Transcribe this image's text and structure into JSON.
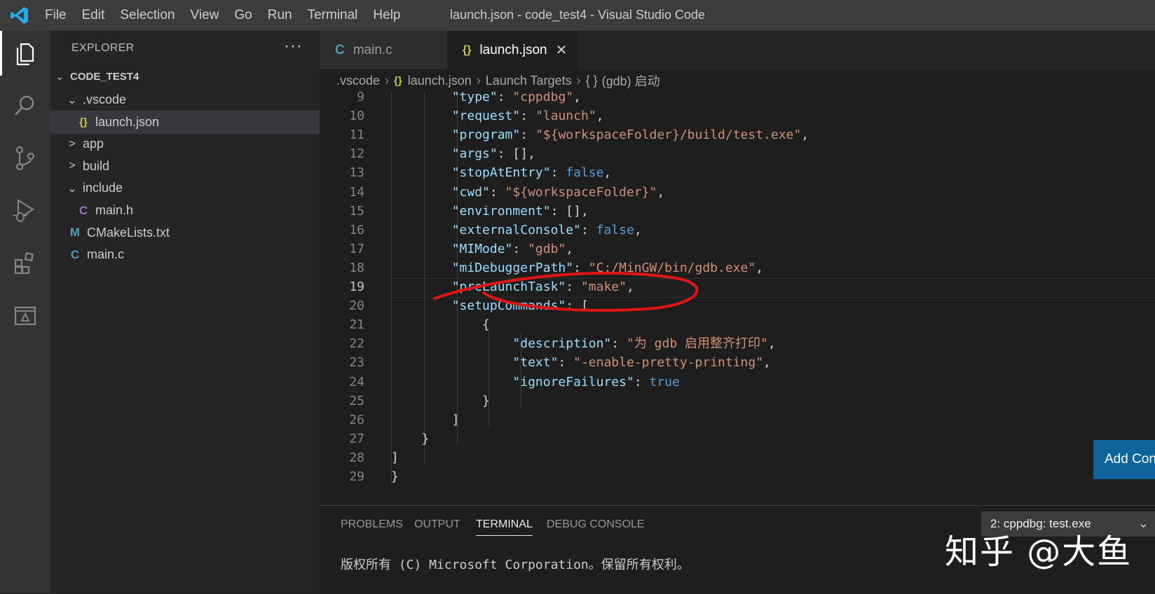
{
  "window": {
    "menu": [
      "File",
      "Edit",
      "Selection",
      "View",
      "Go",
      "Run",
      "Terminal",
      "Help"
    ],
    "title": "launch.json - code_test4 - Visual Studio Code"
  },
  "activity_bar": {
    "items": [
      "explorer-icon",
      "search-icon",
      "source-control-icon",
      "run-debug-icon",
      "extensions-icon",
      "remote-explorer-icon"
    ],
    "active": "explorer-icon"
  },
  "sidebar": {
    "title": "EXPLORER",
    "more": "···",
    "root": "CODE_TEST4",
    "tree": [
      {
        "label": ".vscode",
        "chevron": "⌄",
        "icon": ""
      },
      {
        "label": "launch.json",
        "chevron": "",
        "icon": "{}"
      },
      {
        "label": "app",
        "chevron": ">",
        "icon": ""
      },
      {
        "label": "build",
        "chevron": ">",
        "icon": ""
      },
      {
        "label": "include",
        "chevron": "⌄",
        "icon": ""
      },
      {
        "label": "main.h",
        "chevron": "",
        "icon": "C"
      },
      {
        "label": "CMakeLists.txt",
        "chevron": "",
        "icon": "M"
      },
      {
        "label": "main.c",
        "chevron": "",
        "icon": "C"
      }
    ],
    "selected": "launch.json"
  },
  "tabs": [
    {
      "label": "main.c",
      "icon": "C"
    },
    {
      "label": "launch.json",
      "icon": "{}",
      "close": "✕"
    }
  ],
  "breadcrumb": {
    "folder": ".vscode",
    "file_icon": "{}",
    "file": "launch.json",
    "section": "Launch Targets",
    "item_icon": "{ }",
    "item": "(gdb) 启动"
  },
  "code_lines": [
    {
      "n": "9",
      "code": "            \"type\": \"cppdbg\","
    },
    {
      "n": "10",
      "code": "            \"request\": \"launch\","
    },
    {
      "n": "11",
      "code": "            \"program\": \"${workspaceFolder}/build/test.exe\","
    },
    {
      "n": "12",
      "code": "            \"args\": [],"
    },
    {
      "n": "13",
      "code": "            \"stopAtEntry\": false,"
    },
    {
      "n": "14",
      "code": "            \"cwd\": \"${workspaceFolder}\","
    },
    {
      "n": "15",
      "code": "            \"environment\": [],"
    },
    {
      "n": "16",
      "code": "            \"externalConsole\": false,"
    },
    {
      "n": "17",
      "code": "            \"MIMode\": \"gdb\","
    },
    {
      "n": "18",
      "code": "            \"miDebuggerPath\": \"C:/MinGW/bin/gdb.exe\","
    },
    {
      "n": "19",
      "code": "            \"preLaunchTask\": \"make\","
    },
    {
      "n": "20",
      "code": "            \"setupCommands\": ["
    },
    {
      "n": "21",
      "code": "                {"
    },
    {
      "n": "22",
      "code": "                    \"description\": \"为 gdb 启用整齐打印\","
    },
    {
      "n": "23",
      "code": "                    \"text\": \"-enable-pretty-printing\","
    },
    {
      "n": "24",
      "code": "                    \"ignoreFailures\": true"
    },
    {
      "n": "25",
      "code": "                }"
    },
    {
      "n": "26",
      "code": "            ]"
    },
    {
      "n": "27",
      "code": "        }"
    },
    {
      "n": "28",
      "code": "    ]"
    },
    {
      "n": "29",
      "code": "}"
    }
  ],
  "current_line": "19",
  "add_config_button": "Add Con",
  "panel": {
    "tabs": [
      "PROBLEMS",
      "OUTPUT",
      "TERMINAL",
      "DEBUG CONSOLE"
    ],
    "active_tab": "TERMINAL",
    "terminal_select": "2: cppdbg: test.exe",
    "terminal_text": "版权所有 (C) Microsoft Corporation。保留所有权利。"
  },
  "watermark": "知乎 @大鱼",
  "colors": {
    "key": "#9cdcfe",
    "string": "#ce9178",
    "boolean": "#569cd6",
    "annotation_circle": "#e01616",
    "accent": "#007acc"
  }
}
